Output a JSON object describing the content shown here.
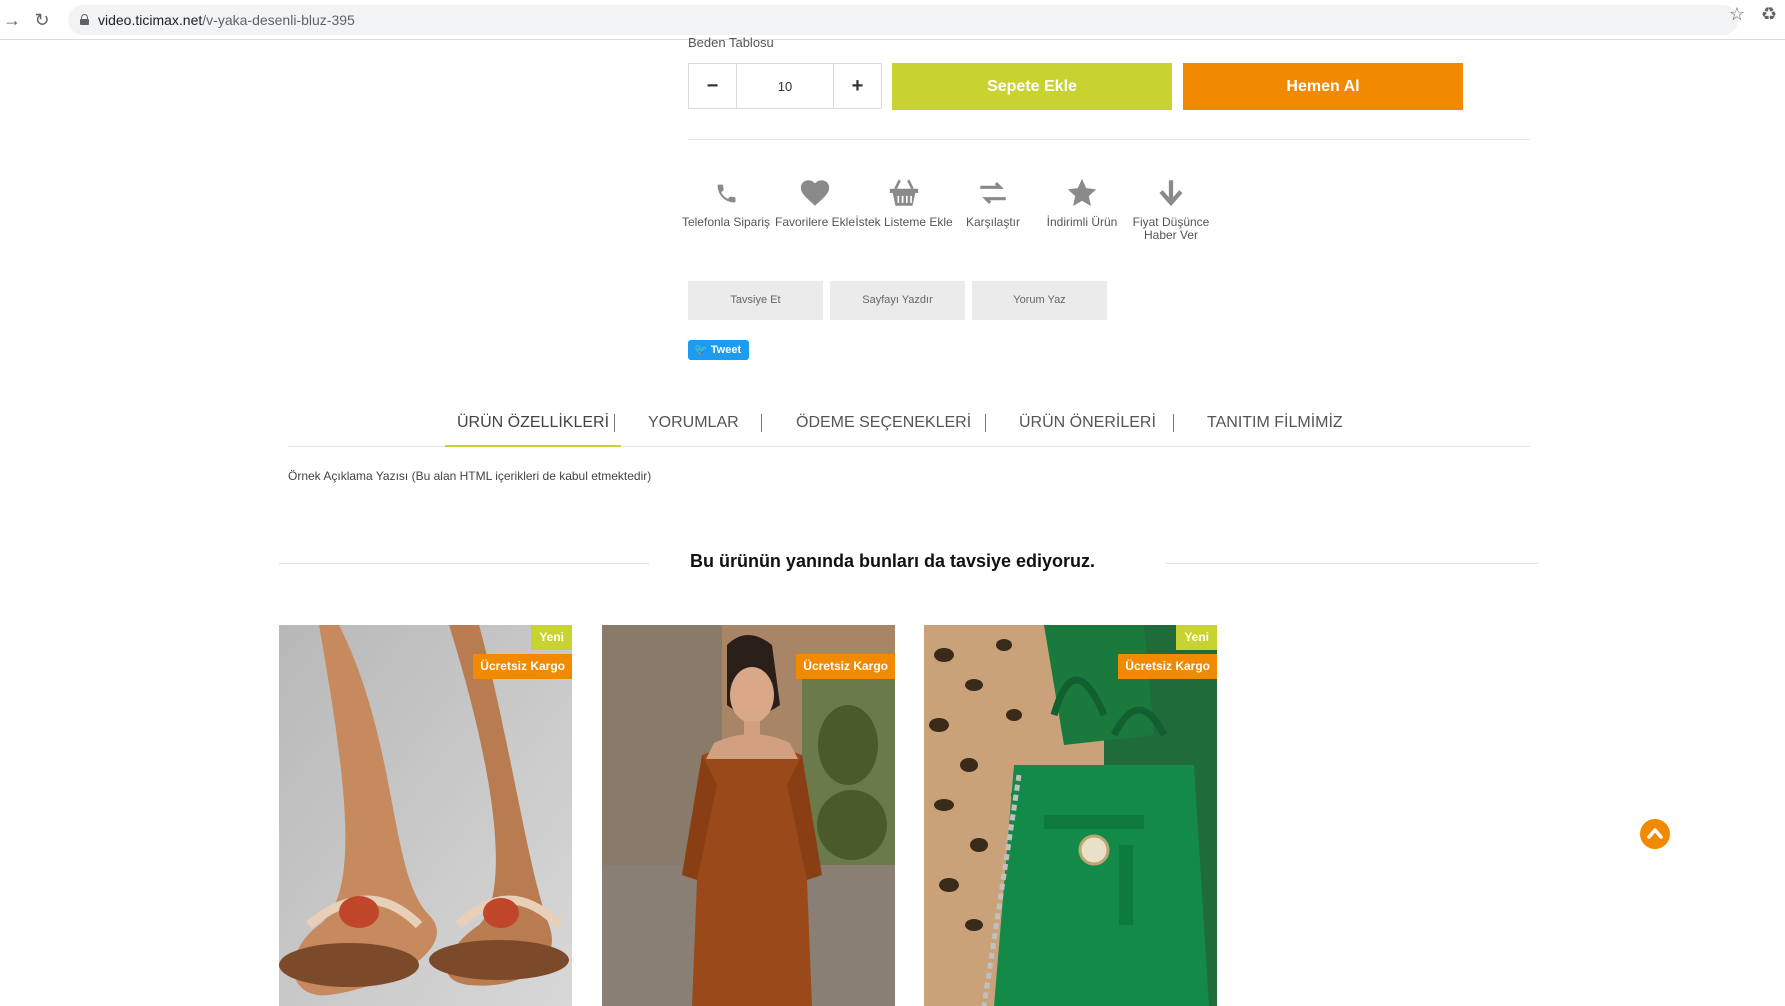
{
  "browser": {
    "url_domain": "video.ticimax.net",
    "url_path": "/v-yaka-desenli-bluz-395"
  },
  "product_panel": {
    "cut_label": "Beden Tablosu",
    "quantity": "10",
    "qty_minus": "−",
    "qty_plus": "+",
    "add_to_cart_label": "Sepete Ekle",
    "buy_now_label": "Hemen Al"
  },
  "actions": [
    {
      "label": "Telefonla Sipariş",
      "icon": "phone-icon"
    },
    {
      "label": "Favorilere Ekle",
      "icon": "heart-icon"
    },
    {
      "label": "İstek Listeme Ekle",
      "icon": "basket-icon"
    },
    {
      "label": "Karşılaştır",
      "icon": "compare-arrows-icon"
    },
    {
      "label": "İndirimli Ürün",
      "icon": "star-icon"
    },
    {
      "label": "Fiyat Düşünce Haber Ver",
      "icon": "arrow-down-icon"
    }
  ],
  "small_buttons": {
    "recommend": "Tavsiye Et",
    "print": "Sayfayı Yazdır",
    "review": "Yorum Yaz"
  },
  "tweet_label": "Tweet",
  "tabs": [
    {
      "label": "ÜRÜN ÖZELLİKLERİ",
      "active": true
    },
    {
      "label": "YORUMLAR",
      "active": false
    },
    {
      "label": "ÖDEME SEÇENEKLERİ",
      "active": false
    },
    {
      "label": "ÜRÜN ÖNERİLERİ",
      "active": false
    },
    {
      "label": "TANITIM FİLMİMİZ",
      "active": false
    }
  ],
  "tab_separator": "|",
  "description": "Örnek Açıklama Yazısı (Bu alan HTML içerikleri de kabul etmektedir)",
  "recommendations": {
    "title": "Bu ürünün yanında bunları da tavsiye ediyoruz.",
    "products": [
      {
        "image": "sandals",
        "badges": [
          "Yeni",
          "Ücretsiz Kargo"
        ]
      },
      {
        "image": "brown-dress",
        "badges": [
          "Ücretsiz Kargo"
        ]
      },
      {
        "image": "green-handbag",
        "badges": [
          "Yeni",
          "Ücretsiz Kargo"
        ]
      }
    ]
  },
  "colors": {
    "accent_green": "#c8d230",
    "accent_orange": "#f18a00"
  }
}
